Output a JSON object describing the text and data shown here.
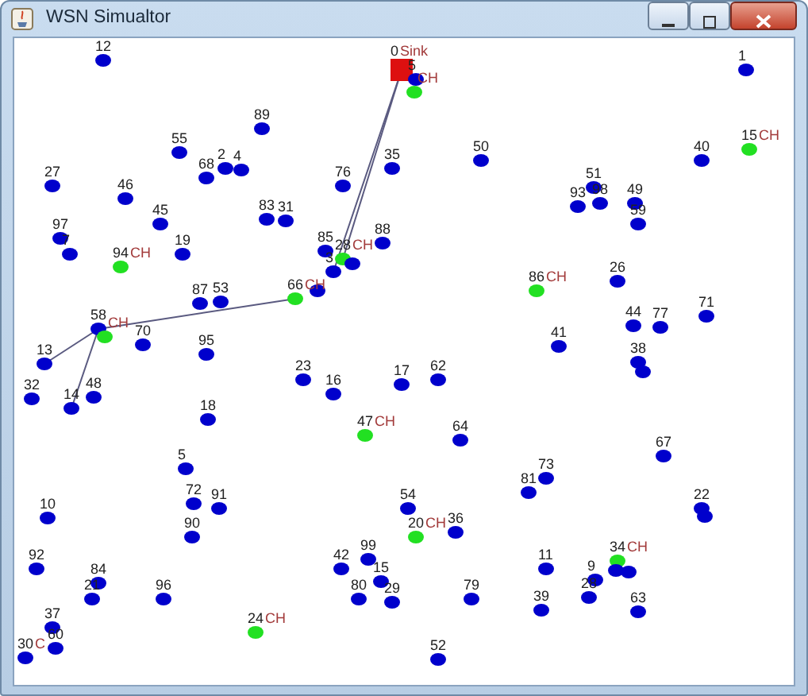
{
  "window": {
    "title": "WSN Simualtor"
  },
  "nodes": [
    {
      "label": "12",
      "kind": "sensor"
    },
    {
      "label": "0",
      "kind": "sink",
      "tag": "Sink"
    },
    {
      "label": "1",
      "kind": "sensor"
    },
    {
      "label": "5",
      "kind": "sensor"
    },
    {
      "kind": "cluster_head",
      "tag": "CH"
    },
    {
      "label": "89",
      "kind": "sensor"
    },
    {
      "label": "55",
      "kind": "sensor"
    },
    {
      "label": "15",
      "kind": "cluster_head",
      "tag": "CH"
    },
    {
      "label": "50",
      "kind": "sensor"
    },
    {
      "label": "40",
      "kind": "sensor"
    },
    {
      "label": "2",
      "kind": "sensor"
    },
    {
      "label": "4",
      "kind": "sensor"
    },
    {
      "label": "35",
      "kind": "sensor"
    },
    {
      "label": "68",
      "kind": "sensor"
    },
    {
      "label": "27",
      "kind": "sensor"
    },
    {
      "label": "76",
      "kind": "sensor"
    },
    {
      "label": "51",
      "kind": "sensor"
    },
    {
      "label": "46",
      "kind": "sensor"
    },
    {
      "label": "93",
      "kind": "sensor"
    },
    {
      "label": "98",
      "kind": "sensor"
    },
    {
      "label": "49",
      "kind": "sensor"
    },
    {
      "label": "45",
      "kind": "sensor"
    },
    {
      "label": "83",
      "kind": "sensor"
    },
    {
      "label": "31",
      "kind": "sensor"
    },
    {
      "label": "59",
      "kind": "sensor"
    },
    {
      "label": "97",
      "kind": "sensor"
    },
    {
      "label": "88",
      "kind": "sensor"
    },
    {
      "label": "7",
      "kind": "sensor"
    },
    {
      "label": "19",
      "kind": "sensor"
    },
    {
      "label": "85",
      "kind": "sensor"
    },
    {
      "label": "28",
      "kind": "cluster_head",
      "tag": "CH"
    },
    {
      "label": "94",
      "kind": "cluster_head",
      "tag": "CH"
    },
    {
      "kind": "sensor"
    },
    {
      "label": "3",
      "kind": "sensor"
    },
    {
      "label": "26",
      "kind": "sensor"
    },
    {
      "kind": "sensor"
    },
    {
      "label": "86",
      "kind": "cluster_head",
      "tag": "CH"
    },
    {
      "label": "87",
      "kind": "sensor"
    },
    {
      "label": "53",
      "kind": "sensor"
    },
    {
      "label": "66",
      "kind": "cluster_head",
      "tag": "CH"
    },
    {
      "label": "71",
      "kind": "sensor"
    },
    {
      "label": "58",
      "kind": "sensor"
    },
    {
      "label": "44",
      "kind": "sensor"
    },
    {
      "label": "77",
      "kind": "sensor"
    },
    {
      "kind": "cluster_head",
      "tag": "CH"
    },
    {
      "label": "70",
      "kind": "sensor"
    },
    {
      "label": "41",
      "kind": "sensor"
    },
    {
      "label": "95",
      "kind": "sensor"
    },
    {
      "label": "13",
      "kind": "sensor"
    },
    {
      "label": "38",
      "kind": "sensor"
    },
    {
      "kind": "sensor"
    },
    {
      "label": "23",
      "kind": "sensor"
    },
    {
      "label": "17",
      "kind": "sensor"
    },
    {
      "label": "62",
      "kind": "sensor"
    },
    {
      "label": "32",
      "kind": "sensor"
    },
    {
      "label": "48",
      "kind": "sensor"
    },
    {
      "label": "16",
      "kind": "sensor"
    },
    {
      "label": "14",
      "kind": "sensor"
    },
    {
      "label": "18",
      "kind": "sensor"
    },
    {
      "label": "47",
      "kind": "cluster_head",
      "tag": "CH"
    },
    {
      "label": "64",
      "kind": "sensor"
    },
    {
      "label": "67",
      "kind": "sensor"
    },
    {
      "label": "5",
      "kind": "sensor"
    },
    {
      "label": "73",
      "kind": "sensor"
    },
    {
      "label": "81",
      "kind": "sensor"
    },
    {
      "label": "72",
      "kind": "sensor"
    },
    {
      "label": "91",
      "kind": "sensor"
    },
    {
      "label": "54",
      "kind": "sensor"
    },
    {
      "label": "22",
      "kind": "sensor"
    },
    {
      "label": "10",
      "kind": "sensor"
    },
    {
      "kind": "sensor"
    },
    {
      "label": "90",
      "kind": "sensor"
    },
    {
      "label": "20",
      "kind": "cluster_head",
      "tag": "CH"
    },
    {
      "label": "36",
      "kind": "sensor"
    },
    {
      "label": "99",
      "kind": "sensor"
    },
    {
      "label": "34",
      "kind": "cluster_head",
      "tag": "CH"
    },
    {
      "label": "92",
      "kind": "sensor"
    },
    {
      "label": "42",
      "kind": "sensor"
    },
    {
      "label": "11",
      "kind": "sensor"
    },
    {
      "kind": "sensor"
    },
    {
      "kind": "sensor"
    },
    {
      "label": "84",
      "kind": "sensor"
    },
    {
      "label": "15",
      "kind": "sensor"
    },
    {
      "label": "9",
      "kind": "sensor"
    },
    {
      "label": "21",
      "kind": "sensor"
    },
    {
      "label": "96",
      "kind": "sensor"
    },
    {
      "label": "80",
      "kind": "sensor"
    },
    {
      "label": "29",
      "kind": "sensor"
    },
    {
      "label": "79",
      "kind": "sensor"
    },
    {
      "label": "28",
      "kind": "sensor"
    },
    {
      "label": "39",
      "kind": "sensor"
    },
    {
      "label": "63",
      "kind": "sensor"
    },
    {
      "label": "37",
      "kind": "sensor"
    },
    {
      "label": "24",
      "kind": "cluster_head",
      "tag": "CH"
    },
    {
      "label": "60",
      "kind": "sensor"
    },
    {
      "label": "30",
      "kind": "sensor",
      "tag": "C"
    },
    {
      "label": "52",
      "kind": "sensor"
    }
  ]
}
